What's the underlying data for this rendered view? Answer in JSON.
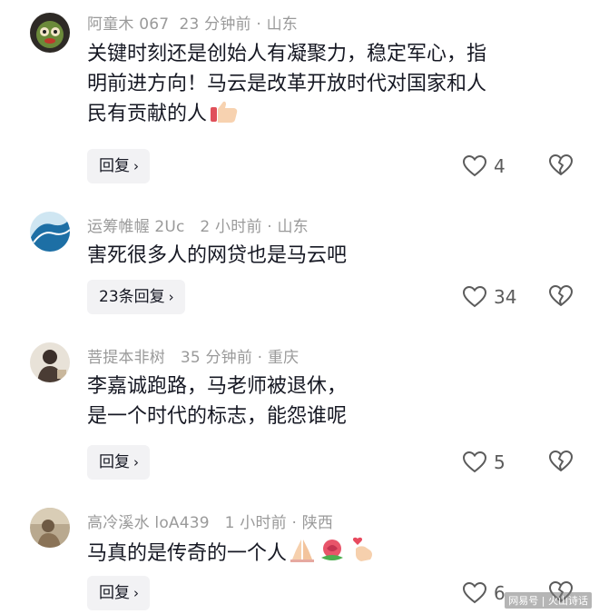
{
  "comments": [
    {
      "username": "阿童木 067",
      "time": "23 分钟前",
      "location": "山东",
      "text": "关键时刻还是创始人有凝聚力，稳定军心，指\n明前进方向！马云是改革开放时代对国家和人\n民有贡献的人",
      "emojis": [
        "thumbs-up-emoji"
      ],
      "reply_label": "回复",
      "likes": "4"
    },
    {
      "username": "运筹帷幄 2Uc",
      "time": "2 小时前",
      "location": "山东",
      "text": "害死很多人的网贷也是马云吧",
      "emojis": [],
      "reply_label": "23条回复",
      "likes": "34"
    },
    {
      "username": "菩提本非树",
      "time": "35 分钟前",
      "location": "重庆",
      "text": "李嘉诚跑路，马老师被退休，\n是一个时代的标志，能怨谁呢",
      "emojis": [],
      "reply_label": "回复",
      "likes": "5"
    },
    {
      "username": "高冷溪水 loA439",
      "time": "1 小时前",
      "location": "陕西",
      "text": "马真的是传奇的一个人",
      "emojis": [
        "praying-hands-emoji",
        "rose-emoji",
        "finger-heart-emoji"
      ],
      "reply_label": "回复",
      "likes": "6"
    }
  ],
  "separator": "·",
  "watermark": "网易号 | 火山诗话",
  "colors": {
    "meta": "#9a9a9a",
    "text": "#161823",
    "reply_bg": "#f2f2f4",
    "icon": "#5b5b5b"
  }
}
